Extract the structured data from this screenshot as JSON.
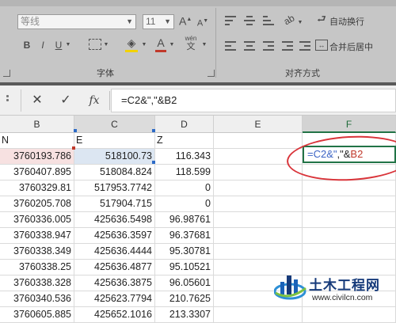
{
  "ribbon": {
    "font_name": "等线",
    "font_size": "11",
    "grow_font": "A",
    "shrink_font": "A",
    "bold": "B",
    "italic": "I",
    "underline": "U",
    "font_color_letter": "A",
    "phonetic_top": "wén",
    "phonetic_bottom": "文",
    "font_group_label": "字体",
    "align_group_label": "对齐方式",
    "wrap_text_label": "自动换行",
    "merge_center_label": "合并后居中",
    "colors": {
      "font_color_bar": "#c0392b",
      "fill_color_bar": "#f2d200"
    }
  },
  "formula_bar": {
    "cancel_icon": "✕",
    "enter_icon": "✓",
    "fx_label": "fx",
    "formula": "=C2&\",\"&B2"
  },
  "sheet": {
    "columns": [
      "B",
      "C",
      "D",
      "E",
      "F"
    ],
    "partial_first_col_text": "N",
    "header_row_cells": {
      "C": "E",
      "D": "Z"
    },
    "rows": [
      {
        "B": "3760193.786",
        "C": "518100.73",
        "D": "116.343"
      },
      {
        "B": "3760407.895",
        "C": "518084.824",
        "D": "118.599"
      },
      {
        "B": "3760329.81",
        "C": "517953.7742",
        "D": "0"
      },
      {
        "B": "3760205.708",
        "C": "517904.715",
        "D": "0"
      },
      {
        "B": "3760336.005",
        "C": "425636.5498",
        "D": "96.98761"
      },
      {
        "B": "3760338.947",
        "C": "425636.3597",
        "D": "96.37681"
      },
      {
        "B": "3760338.349",
        "C": "425636.4444",
        "D": "95.30781"
      },
      {
        "B": "3760338.25",
        "C": "425636.4877",
        "D": "95.10521"
      },
      {
        "B": "3760338.328",
        "C": "425636.3875",
        "D": "96.05601"
      },
      {
        "B": "3760340.536",
        "C": "425623.7794",
        "D": "210.7625"
      },
      {
        "B": "3760605.885",
        "C": "425652.1016",
        "D": "213.3307"
      }
    ],
    "editing_cell": {
      "column": "F",
      "part1": "=C2&\"",
      "part2": ",\"&",
      "part3": "B2"
    },
    "colors": {
      "ref_c": "#3b63c4",
      "ref_b": "#c0392b",
      "active_border": "#217346",
      "annotation_ellipse": "#d9343a"
    }
  },
  "watermark": {
    "title": "土木工程网",
    "url": "www.civilcn.com"
  }
}
